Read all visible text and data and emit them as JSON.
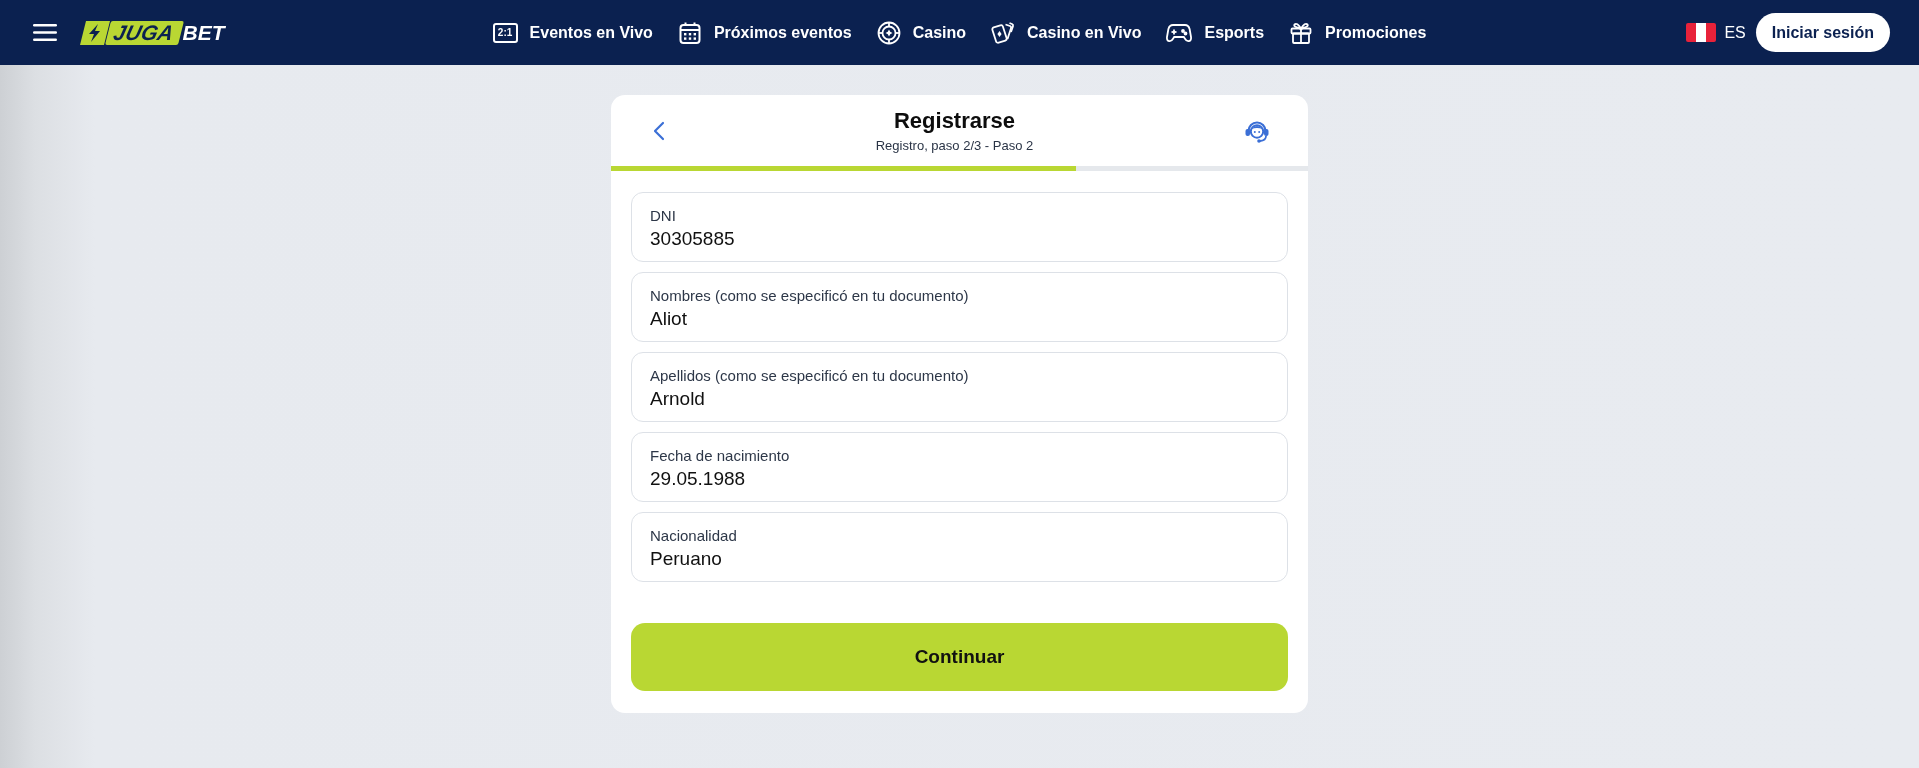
{
  "header": {
    "logo": {
      "badge_text": "JUGA",
      "text": "BET"
    },
    "nav": [
      {
        "label": "Eventos en Vivo",
        "icon_text": "2:1"
      },
      {
        "label": "Próximos eventos"
      },
      {
        "label": "Casino"
      },
      {
        "label": "Casino en Vivo"
      },
      {
        "label": "Esports"
      },
      {
        "label": "Promociones"
      }
    ],
    "language": "ES",
    "login_button": "Iniciar sesión"
  },
  "registration": {
    "title": "Registrarse",
    "subtitle": "Registro, paso 2/3 - Paso 2",
    "progress": {
      "level": 0.667
    },
    "fields": [
      {
        "label": "DNI",
        "value": "30305885"
      },
      {
        "label": "Nombres (como se especificó en tu documento)",
        "value": "Aliot"
      },
      {
        "label": "Apellidos (como se especificó en tu documento)",
        "value": "Arnold"
      },
      {
        "label": "Fecha de nacimiento",
        "value": "29.05.1988"
      },
      {
        "label": "Nacionalidad",
        "value": "Peruano"
      }
    ],
    "submit_button": "Continuar"
  }
}
